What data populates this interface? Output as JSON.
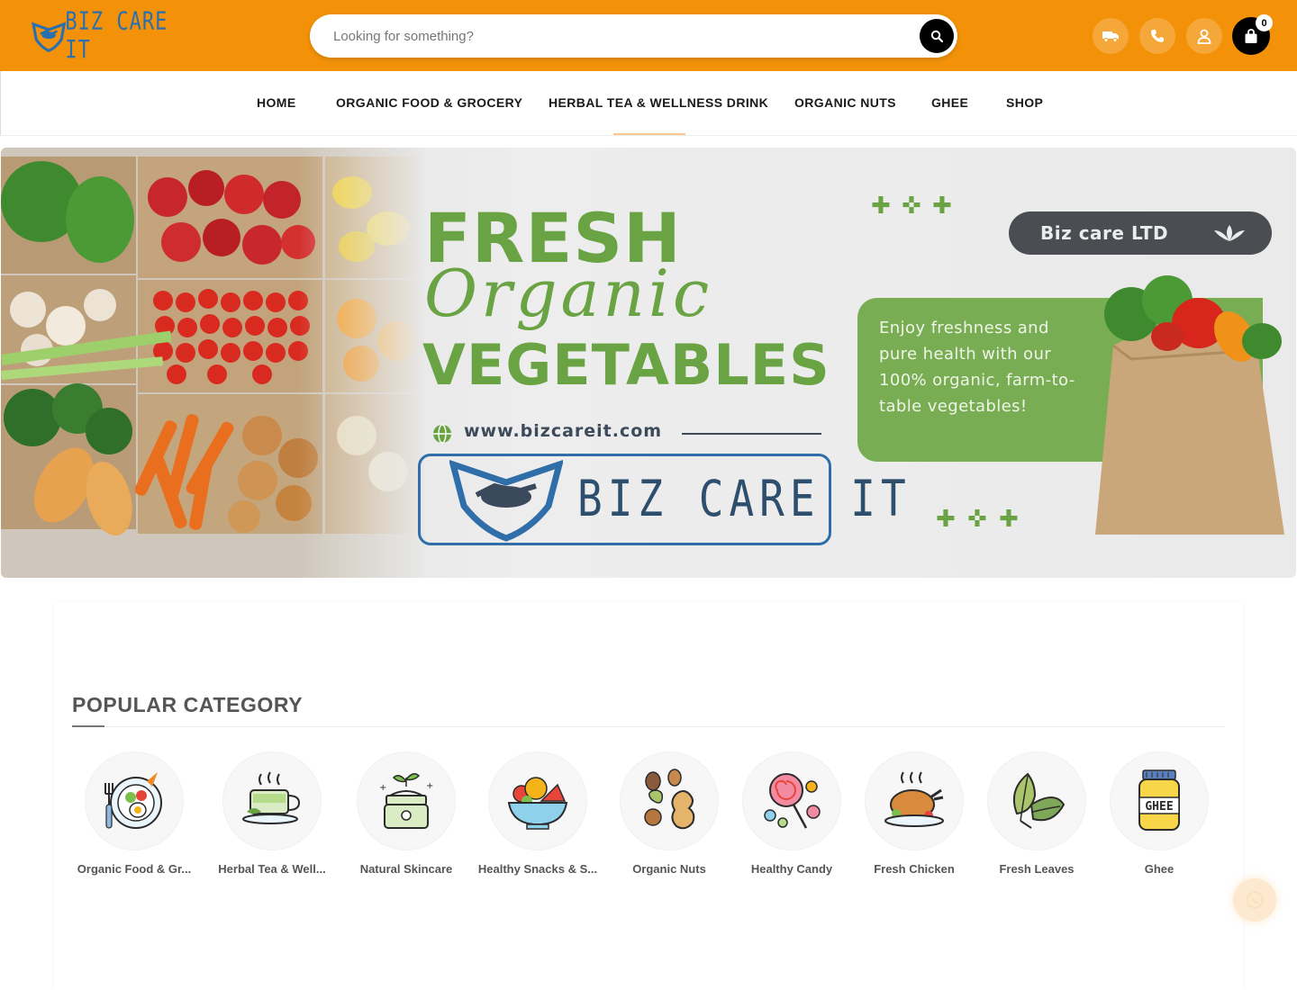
{
  "header": {
    "logo_text": "BIZ CARE IT",
    "search_placeholder": "Looking for something?",
    "cart_count": "0",
    "icons": [
      "truck-icon",
      "phone-icon",
      "user-icon",
      "shopping-bag-icon"
    ],
    "colors": {
      "brand": "#f39208",
      "cart": "#000000"
    }
  },
  "nav": {
    "items": [
      {
        "label": "HOME"
      },
      {
        "label": "ORGANIC FOOD & GROCERY"
      },
      {
        "label": "HERBAL TEA & WELLNESS DRINK"
      },
      {
        "label": "ORGANIC NUTS"
      },
      {
        "label": "GHEE"
      },
      {
        "label": "SHOP"
      }
    ]
  },
  "banner": {
    "title_line1": "FRESH",
    "title_line2": "Organic",
    "title_line3": "VEGETABLES",
    "website": "www.bizcareit.com",
    "logo_text": "BIZ CARE IT",
    "company_pill": "Biz care LTD",
    "tagline": "Enjoy freshness and pure health with our 100% organic, farm-to-table vegetables!",
    "accent": "#6aa343"
  },
  "popular_category": {
    "title": "POPULAR CATEGORY",
    "items": [
      {
        "label": "Organic Food & Gr...",
        "icon": "salad-plate-icon"
      },
      {
        "label": "Herbal Tea & Well...",
        "icon": "tea-cup-icon"
      },
      {
        "label": "Natural Skincare",
        "icon": "cream-jar-icon"
      },
      {
        "label": "Healthy Snacks & S...",
        "icon": "fruit-bowl-icon"
      },
      {
        "label": "Organic Nuts",
        "icon": "nuts-icon"
      },
      {
        "label": "Healthy Candy",
        "icon": "candy-icon"
      },
      {
        "label": "Fresh Chicken",
        "icon": "roast-chicken-icon"
      },
      {
        "label": "Fresh Leaves",
        "icon": "leaves-icon"
      },
      {
        "label": "Ghee",
        "icon": "ghee-jar-icon"
      }
    ]
  },
  "floating": {
    "icon": "whatsapp-icon"
  }
}
